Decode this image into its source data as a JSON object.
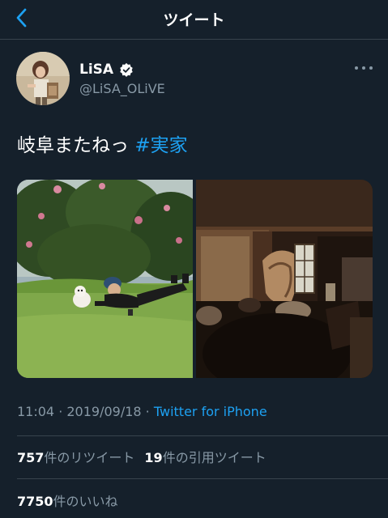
{
  "nav": {
    "title": "ツイート",
    "back_icon": "chevron-left-icon"
  },
  "tweet": {
    "display_name": "LiSA",
    "verified": true,
    "handle": "@LiSA_OLiVE",
    "text": "岐阜またねっ",
    "hashtag": "#実家",
    "time": "11:04",
    "separator": " · ",
    "date": "2019/09/18",
    "separator2": " · ",
    "source": "Twitter for iPhone",
    "photos": [
      {
        "description_icon": "photo-dog-meadow"
      },
      {
        "description_icon": "photo-house-interior"
      }
    ]
  },
  "stats": {
    "retweets_count": "757",
    "retweets_label": "件のリツイート",
    "quotes_count": "19",
    "quotes_label": "件の引用ツイート",
    "likes_count": "7750",
    "likes_label": "件のいいね"
  },
  "colors": {
    "background": "#15202b",
    "accent": "#1da1f2",
    "secondary_text": "#8899a6",
    "divider": "#38444d"
  }
}
